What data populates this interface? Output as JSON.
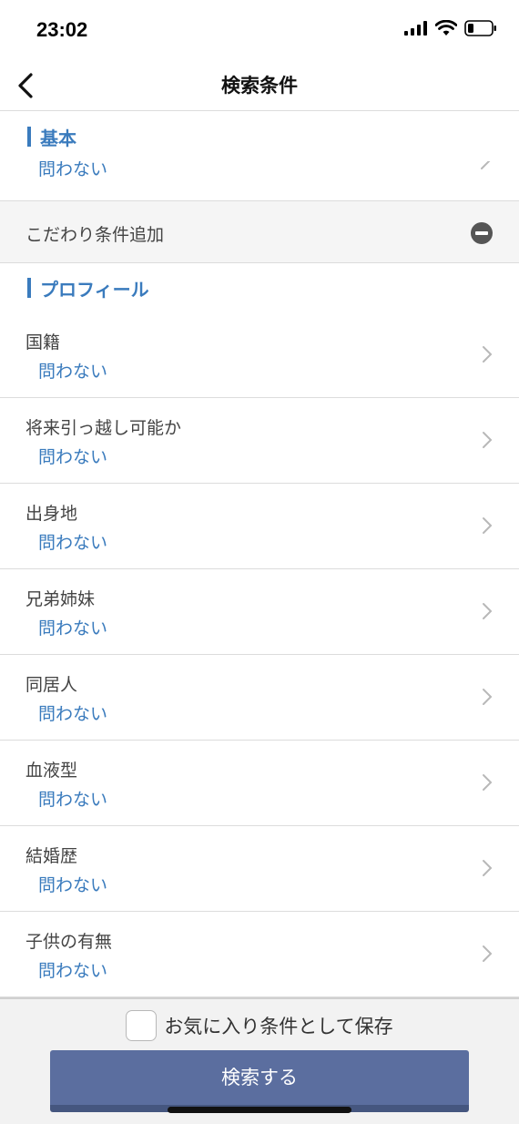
{
  "status": {
    "time": "23:02"
  },
  "nav": {
    "title": "検索条件"
  },
  "sections": {
    "basic": {
      "label": "基本",
      "partial_value": "問わない"
    },
    "addon": {
      "label": "こだわり条件追加"
    },
    "profile": {
      "label": "プロフィール"
    }
  },
  "rows": [
    {
      "title": "国籍",
      "value": "問わない"
    },
    {
      "title": "将来引っ越し可能か",
      "value": "問わない"
    },
    {
      "title": "出身地",
      "value": "問わない"
    },
    {
      "title": "兄弟姉妹",
      "value": "問わない"
    },
    {
      "title": "同居人",
      "value": "問わない"
    },
    {
      "title": "血液型",
      "value": "問わない"
    },
    {
      "title": "結婚歴",
      "value": "問わない"
    },
    {
      "title": "子供の有無",
      "value": "問わない"
    }
  ],
  "footer": {
    "save_label": "お気に入り条件として保存",
    "search_label": "検索する"
  },
  "colors": {
    "accent": "#3a7bbd",
    "button": "#5b6e9f"
  }
}
